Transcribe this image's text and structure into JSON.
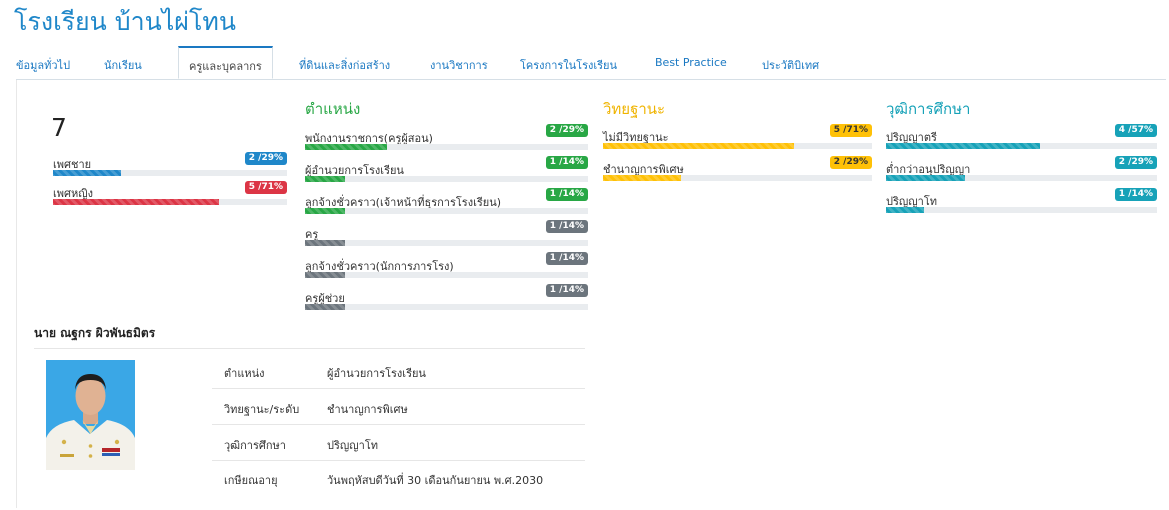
{
  "school_name": "โรงเรียน บ้านไผ่โทน",
  "tabs": [
    "ข้อมูลทั่วไป",
    "นักเรียน",
    "ครูและบุคลากร",
    "ที่ดินและสิ่งก่อสร้าง",
    "งานวิชาการ",
    "โครงการในโรงเรียน",
    "Best Practice",
    "ประวัติบิเทศ"
  ],
  "active_tab": "ครูและบุคลากร",
  "colors": {
    "blue": "#1f87c9",
    "green": "#28a745",
    "yellow": "#ffc107",
    "red": "#dc3545",
    "teal": "#17a2b8",
    "gray": "#6c757d"
  },
  "gender": {
    "total": "7",
    "rows": [
      {
        "label": "เพศชาย",
        "badge": "2 /29%",
        "percent": 29,
        "color": "blue"
      },
      {
        "label": "เพศหญิง",
        "badge": "5 /71%",
        "percent": 71,
        "color": "red"
      }
    ]
  },
  "position": {
    "title": "ตำแหน่ง",
    "rows": [
      {
        "label": "พนักงานราชการ(ครูผู้สอน)",
        "badge": "2 /29%",
        "percent": 29,
        "color": "green"
      },
      {
        "label": "ผู้อำนวยการโรงเรียน",
        "badge": "1 /14%",
        "percent": 14,
        "color": "green"
      },
      {
        "label": "ลูกจ้างชั่วคราว(เจ้าหน้าที่ธุรการโรงเรียน)",
        "badge": "1 /14%",
        "percent": 14,
        "color": "green"
      },
      {
        "label": "ครู",
        "badge": "1 /14%",
        "percent": 14,
        "color": "gray"
      },
      {
        "label": "ลูกจ้างชั่วคราว(นักการภารโรง)",
        "badge": "1 /14%",
        "percent": 14,
        "color": "gray"
      },
      {
        "label": "ครูผู้ช่วย",
        "badge": "1 /14%",
        "percent": 14,
        "color": "gray"
      }
    ]
  },
  "academic_rank": {
    "title": "วิทยฐานะ",
    "rows": [
      {
        "label": "ไม่มีวิทยฐานะ",
        "badge": "5 /71%",
        "percent": 71,
        "color": "yellow"
      },
      {
        "label": "ชำนาญการพิเศษ",
        "badge": "2 /29%",
        "percent": 29,
        "color": "yellow"
      }
    ]
  },
  "education": {
    "title": "วุฒิการศึกษา",
    "rows": [
      {
        "label": "ปริญญาตรี",
        "badge": "4 /57%",
        "percent": 57,
        "color": "teal"
      },
      {
        "label": "ต่ำกว่าอนุปริญญา",
        "badge": "2 /29%",
        "percent": 29,
        "color": "teal"
      },
      {
        "label": "ปริญญาโท",
        "badge": "1 /14%",
        "percent": 14,
        "color": "teal"
      }
    ]
  },
  "director": {
    "name": "นาย ณฐกร ผิวพันธมิตร",
    "details": [
      {
        "label": "ตำแหน่ง",
        "value": "ผู้อำนวยการโรงเรียน"
      },
      {
        "label": "วิทยฐานะ/ระดับ",
        "value": "ชำนาญการพิเศษ"
      },
      {
        "label": "วุฒิการศึกษา",
        "value": "ปริญญาโท"
      },
      {
        "label": "เกษียณอายุ",
        "value": "วันพฤหัสบดีวันที่ 30 เดือนกันยายน พ.ศ.2030"
      }
    ]
  }
}
